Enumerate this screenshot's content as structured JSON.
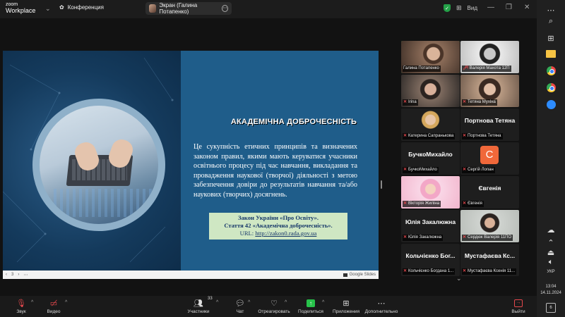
{
  "titlebar": {
    "logo_line1": "zoom",
    "logo_line2": "Workplace",
    "conference_label": "Конференция",
    "share_label": "Экран (Галина Потапенко)",
    "view_label": "Вид"
  },
  "slide": {
    "heading": "АКАДЕМІЧНА ДОБРОЧЕСНІСТЬ",
    "body": "Це сукупність етичних принципів та визначених законом правил, якими мають керуватися учасники освітнього процесу під час навчання, викладання та провадження наукової (творчої) діяльності з метою забезпечення довіри до результатів навчання та/або наукових (творчих) досягнень.",
    "law_line1": "Закон України «Про Освіту».",
    "law_line2": "Стаття 42 «Академічна доброчесність».",
    "law_url_prefix": "URL: ",
    "law_url": "http://zakon0.rada.gov.ua"
  },
  "slides_bar": {
    "prev": "‹",
    "page": "3",
    "next": "›",
    "more": "⋯",
    "brand": "Google Slides"
  },
  "participants": [
    {
      "label": "Галина Потапенко",
      "bigname": "",
      "muted": false,
      "active": true
    },
    {
      "label": "Валерія Махота 12П",
      "bigname": "",
      "muted": true,
      "active": false
    },
    {
      "label": "Irina",
      "bigname": "",
      "muted": true,
      "active": false
    },
    {
      "label": "Тетяна Мухіна",
      "bigname": "",
      "muted": true,
      "active": false
    },
    {
      "label": "Катерина Сапранькова",
      "bigname": "",
      "muted": true,
      "active": false
    },
    {
      "label": "Портнова Тетяна",
      "bigname": "Портнова Тетяна",
      "muted": true,
      "active": false
    },
    {
      "label": "БучкоМихайло",
      "bigname": "БучкоМихайло",
      "muted": true,
      "active": false
    },
    {
      "label": "Сергій Лопан",
      "bigname": "",
      "muted": true,
      "active": false,
      "avatar": "C"
    },
    {
      "label": "Вікторія Жиліна",
      "bigname": "",
      "muted": true,
      "active": false
    },
    {
      "label": "Євгенія",
      "bigname": "Євгенія",
      "muted": true,
      "active": false
    },
    {
      "label": "Юлія Закалюжна",
      "bigname": "Юлія Закалюжна",
      "muted": true,
      "active": false
    },
    {
      "label": "Сердюк Валерія 11ПО",
      "bigname": "",
      "muted": true,
      "active": false
    },
    {
      "label": "Кольчієнко Богдана 1...",
      "bigname": "Кольчієнко Бог...",
      "muted": true,
      "active": false
    },
    {
      "label": "Мустафаєва Ксенія 11...",
      "bigname": "Мустафаєва Кс...",
      "muted": true,
      "active": false
    }
  ],
  "toolbar": {
    "audio": "Звук",
    "video": "Видео",
    "participants": "Участники",
    "participants_count": "33",
    "chat": "Чат",
    "react": "Отреагировать",
    "share": "Поделиться",
    "apps": "Приложения",
    "more": "Дополнительно",
    "leave": "Выйти"
  },
  "taskbar": {
    "lang": "УКР",
    "time": "13:04",
    "date": "14.11.2024",
    "notifications": "6"
  }
}
